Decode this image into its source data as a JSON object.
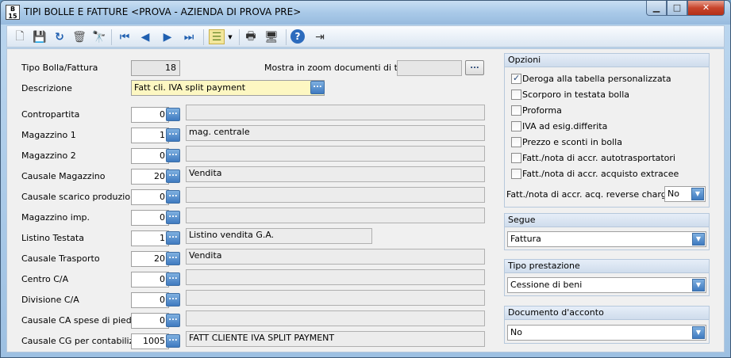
{
  "window": {
    "title": "TIPI BOLLE E FATTURE <PROVA - AZIENDA DI PROVA PRE>",
    "app_icon_line1": "B",
    "app_icon_line2": "15",
    "min_glyph": "▁",
    "max_glyph": "□",
    "close_glyph": "✕"
  },
  "toolbar": {
    "icons": [
      "new-icon",
      "save-icon",
      "undo-icon",
      "delete-icon",
      "search-icon",
      "first-icon",
      "prev-icon",
      "next-icon",
      "last-icon",
      "list-icon",
      "print-icon",
      "preview-icon",
      "help-icon",
      "exit-icon"
    ],
    "glyphs": {
      "new": "🗋",
      "save": "💾",
      "undo": "↻",
      "delete": "🗑",
      "search": "🔭",
      "first": "⏮",
      "prev": "◀",
      "next": "▶",
      "last": "⏭",
      "list": "☰",
      "print": "🖶",
      "preview": "🖥",
      "help": "?",
      "exit": "⇥"
    }
  },
  "form": {
    "tipo_bolla": {
      "label": "Tipo Bolla/Fattura",
      "value": "18"
    },
    "mostra_zoom": {
      "label": "Mostra in zoom documenti di tipo",
      "value": ""
    },
    "descrizione": {
      "label": "Descrizione",
      "value": "Fatt cli. IVA split payment"
    },
    "rows": [
      {
        "label": "Contropartita",
        "value": "0",
        "desc": ""
      },
      {
        "label": "Magazzino 1",
        "value": "1",
        "desc": "mag. centrale"
      },
      {
        "label": "Magazzino 2",
        "value": "0",
        "desc": ""
      },
      {
        "label": "Causale Magazzino",
        "value": "20",
        "desc": "Vendita"
      },
      {
        "label": "Causale scarico produzione",
        "value": "0",
        "desc": ""
      },
      {
        "label": "Magazzino imp.",
        "value": "0",
        "desc": ""
      },
      {
        "label": "Listino Testata",
        "value": "1",
        "desc": "Listino vendita G.A."
      },
      {
        "label": "Causale Trasporto",
        "value": "20",
        "desc": "Vendita"
      },
      {
        "label": "Centro C/A",
        "value": "0",
        "desc": ""
      },
      {
        "label": "Divisione C/A",
        "value": "0",
        "desc": ""
      },
      {
        "label": "Causale CA spese di piede",
        "value": "0",
        "desc": ""
      },
      {
        "label": "Causale CG per contabilizz.",
        "value": "1005",
        "desc": "FATT CLIENTE IVA SPLIT PAYMENT"
      }
    ],
    "dots_glyph": "..."
  },
  "opzioni": {
    "title": "Opzioni",
    "checkboxes": [
      {
        "label": "Deroga alla tabella personalizzata",
        "checked": true
      },
      {
        "label": "Scorporo in testata bolla",
        "checked": false
      },
      {
        "label": "Proforma",
        "checked": false
      },
      {
        "label": "IVA ad esig.differita",
        "checked": false
      },
      {
        "label": "Prezzo e sconti in bolla",
        "checked": false
      },
      {
        "label": "Fatt./nota di accr. autotrasportatori",
        "checked": false
      },
      {
        "label": "Fatt./nota di accr. acquisto extracee",
        "checked": false
      }
    ],
    "reverse_charge": {
      "label": "Fatt./nota di accr. acq. reverse charge",
      "value": "No"
    }
  },
  "segue": {
    "title": "Segue",
    "value": "Fattura"
  },
  "tipo_prestazione": {
    "title": "Tipo prestazione",
    "value": "Cessione di beni"
  },
  "documento_acconto": {
    "title": "Documento d'acconto",
    "value": "No"
  },
  "dropdown_glyph": "▼"
}
